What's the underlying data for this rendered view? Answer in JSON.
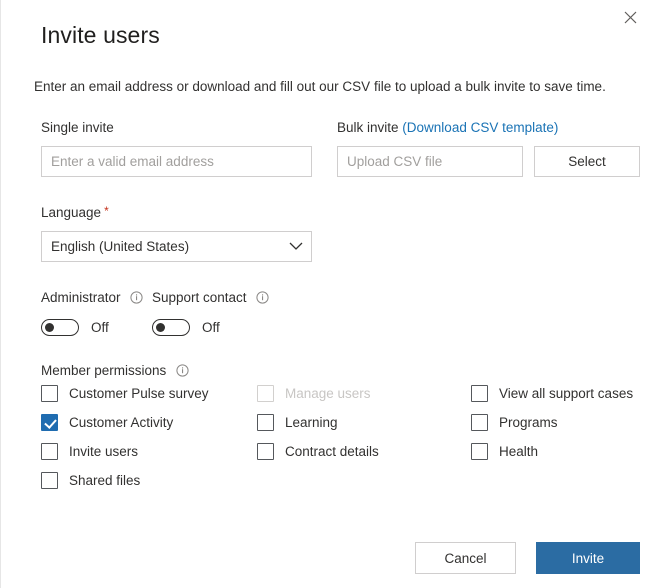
{
  "dialog": {
    "title": "Invite users",
    "subtitle": "Enter an email address or download and fill out our CSV file to upload a bulk invite to save time.",
    "close_icon": "close-icon"
  },
  "single_invite": {
    "label": "Single invite",
    "placeholder": "Enter a valid email address",
    "value": ""
  },
  "bulk_invite": {
    "label": "Bulk invite",
    "link_text": "(Download CSV template)",
    "placeholder": "Upload CSV file",
    "value": "",
    "select_button": "Select"
  },
  "language": {
    "label": "Language",
    "required_marker": "*",
    "selected": "English (United States)",
    "chevron_icon": "chevron-down-icon"
  },
  "toggles": [
    {
      "label": "Administrator",
      "state_text": "Off",
      "on": false,
      "info_icon": "info-icon"
    },
    {
      "label": "Support contact",
      "state_text": "Off",
      "on": false,
      "info_icon": "info-icon"
    }
  ],
  "member_permissions": {
    "label": "Member permissions",
    "info_icon": "info-icon",
    "items": [
      {
        "label": "Customer Pulse survey",
        "checked": false,
        "disabled": false
      },
      {
        "label": "Customer Activity",
        "checked": true,
        "disabled": false
      },
      {
        "label": "Invite users",
        "checked": false,
        "disabled": false
      },
      {
        "label": "Shared files",
        "checked": false,
        "disabled": false
      },
      {
        "label": "Manage users",
        "checked": false,
        "disabled": true
      },
      {
        "label": "Learning",
        "checked": false,
        "disabled": false
      },
      {
        "label": "Contract details",
        "checked": false,
        "disabled": false
      },
      {
        "label": "View all support cases",
        "checked": false,
        "disabled": false
      },
      {
        "label": "Programs",
        "checked": false,
        "disabled": false
      },
      {
        "label": "Health",
        "checked": false,
        "disabled": false
      }
    ]
  },
  "footer": {
    "cancel_label": "Cancel",
    "invite_label": "Invite"
  },
  "colors": {
    "primary": "#2b6ca3",
    "link": "#1a73b5",
    "checkbox_checked": "#1f6cb0",
    "required": "#c4301b",
    "border": "#d0cece",
    "text": "#323130",
    "disabled_text": "#c8c6c4"
  }
}
